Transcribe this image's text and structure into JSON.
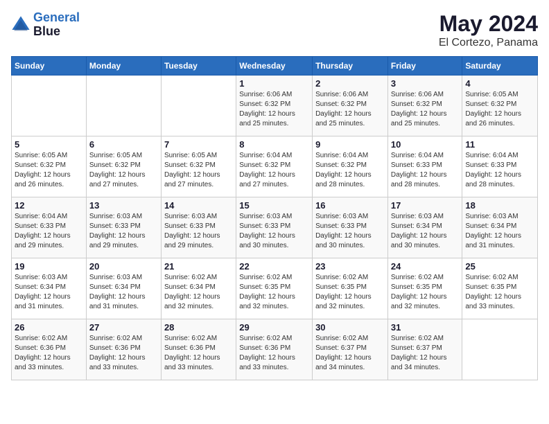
{
  "header": {
    "logo_line1": "General",
    "logo_line2": "Blue",
    "title": "May 2024",
    "subtitle": "El Cortezo, Panama"
  },
  "weekdays": [
    "Sunday",
    "Monday",
    "Tuesday",
    "Wednesday",
    "Thursday",
    "Friday",
    "Saturday"
  ],
  "weeks": [
    [
      {
        "day": "",
        "info": ""
      },
      {
        "day": "",
        "info": ""
      },
      {
        "day": "",
        "info": ""
      },
      {
        "day": "1",
        "info": "Sunrise: 6:06 AM\nSunset: 6:32 PM\nDaylight: 12 hours\nand 25 minutes."
      },
      {
        "day": "2",
        "info": "Sunrise: 6:06 AM\nSunset: 6:32 PM\nDaylight: 12 hours\nand 25 minutes."
      },
      {
        "day": "3",
        "info": "Sunrise: 6:06 AM\nSunset: 6:32 PM\nDaylight: 12 hours\nand 25 minutes."
      },
      {
        "day": "4",
        "info": "Sunrise: 6:05 AM\nSunset: 6:32 PM\nDaylight: 12 hours\nand 26 minutes."
      }
    ],
    [
      {
        "day": "5",
        "info": "Sunrise: 6:05 AM\nSunset: 6:32 PM\nDaylight: 12 hours\nand 26 minutes."
      },
      {
        "day": "6",
        "info": "Sunrise: 6:05 AM\nSunset: 6:32 PM\nDaylight: 12 hours\nand 27 minutes."
      },
      {
        "day": "7",
        "info": "Sunrise: 6:05 AM\nSunset: 6:32 PM\nDaylight: 12 hours\nand 27 minutes."
      },
      {
        "day": "8",
        "info": "Sunrise: 6:04 AM\nSunset: 6:32 PM\nDaylight: 12 hours\nand 27 minutes."
      },
      {
        "day": "9",
        "info": "Sunrise: 6:04 AM\nSunset: 6:32 PM\nDaylight: 12 hours\nand 28 minutes."
      },
      {
        "day": "10",
        "info": "Sunrise: 6:04 AM\nSunset: 6:33 PM\nDaylight: 12 hours\nand 28 minutes."
      },
      {
        "day": "11",
        "info": "Sunrise: 6:04 AM\nSunset: 6:33 PM\nDaylight: 12 hours\nand 28 minutes."
      }
    ],
    [
      {
        "day": "12",
        "info": "Sunrise: 6:04 AM\nSunset: 6:33 PM\nDaylight: 12 hours\nand 29 minutes."
      },
      {
        "day": "13",
        "info": "Sunrise: 6:03 AM\nSunset: 6:33 PM\nDaylight: 12 hours\nand 29 minutes."
      },
      {
        "day": "14",
        "info": "Sunrise: 6:03 AM\nSunset: 6:33 PM\nDaylight: 12 hours\nand 29 minutes."
      },
      {
        "day": "15",
        "info": "Sunrise: 6:03 AM\nSunset: 6:33 PM\nDaylight: 12 hours\nand 30 minutes."
      },
      {
        "day": "16",
        "info": "Sunrise: 6:03 AM\nSunset: 6:33 PM\nDaylight: 12 hours\nand 30 minutes."
      },
      {
        "day": "17",
        "info": "Sunrise: 6:03 AM\nSunset: 6:34 PM\nDaylight: 12 hours\nand 30 minutes."
      },
      {
        "day": "18",
        "info": "Sunrise: 6:03 AM\nSunset: 6:34 PM\nDaylight: 12 hours\nand 31 minutes."
      }
    ],
    [
      {
        "day": "19",
        "info": "Sunrise: 6:03 AM\nSunset: 6:34 PM\nDaylight: 12 hours\nand 31 minutes."
      },
      {
        "day": "20",
        "info": "Sunrise: 6:03 AM\nSunset: 6:34 PM\nDaylight: 12 hours\nand 31 minutes."
      },
      {
        "day": "21",
        "info": "Sunrise: 6:02 AM\nSunset: 6:34 PM\nDaylight: 12 hours\nand 32 minutes."
      },
      {
        "day": "22",
        "info": "Sunrise: 6:02 AM\nSunset: 6:35 PM\nDaylight: 12 hours\nand 32 minutes."
      },
      {
        "day": "23",
        "info": "Sunrise: 6:02 AM\nSunset: 6:35 PM\nDaylight: 12 hours\nand 32 minutes."
      },
      {
        "day": "24",
        "info": "Sunrise: 6:02 AM\nSunset: 6:35 PM\nDaylight: 12 hours\nand 32 minutes."
      },
      {
        "day": "25",
        "info": "Sunrise: 6:02 AM\nSunset: 6:35 PM\nDaylight: 12 hours\nand 33 minutes."
      }
    ],
    [
      {
        "day": "26",
        "info": "Sunrise: 6:02 AM\nSunset: 6:36 PM\nDaylight: 12 hours\nand 33 minutes."
      },
      {
        "day": "27",
        "info": "Sunrise: 6:02 AM\nSunset: 6:36 PM\nDaylight: 12 hours\nand 33 minutes."
      },
      {
        "day": "28",
        "info": "Sunrise: 6:02 AM\nSunset: 6:36 PM\nDaylight: 12 hours\nand 33 minutes."
      },
      {
        "day": "29",
        "info": "Sunrise: 6:02 AM\nSunset: 6:36 PM\nDaylight: 12 hours\nand 33 minutes."
      },
      {
        "day": "30",
        "info": "Sunrise: 6:02 AM\nSunset: 6:37 PM\nDaylight: 12 hours\nand 34 minutes."
      },
      {
        "day": "31",
        "info": "Sunrise: 6:02 AM\nSunset: 6:37 PM\nDaylight: 12 hours\nand 34 minutes."
      },
      {
        "day": "",
        "info": ""
      }
    ]
  ]
}
